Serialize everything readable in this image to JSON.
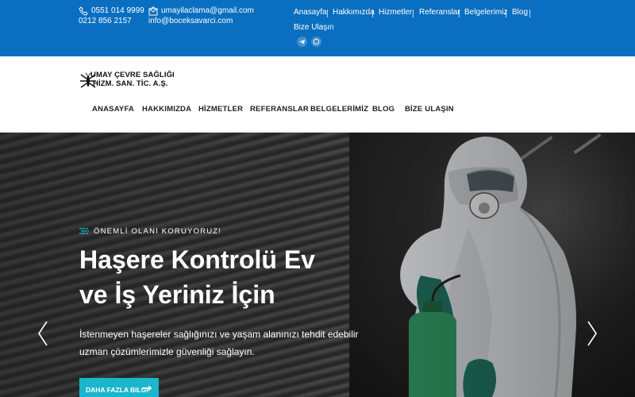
{
  "topbar": {
    "phone1": "0551 014 9999",
    "phone2": "0212 856 2157",
    "email1": "umayilaclama@gmail.com",
    "email2": "info@boceksavarci.com",
    "nav": [
      "Anasayfa",
      "Hakkımızda",
      "Hizmetler",
      "Referanslar",
      "Belgelerimiz",
      "Blog",
      "Bize Ulaşın"
    ],
    "social_icons": [
      "telegram-icon",
      "whatsapp-icon"
    ],
    "bg_color": "#0a6fc0"
  },
  "header": {
    "logo_line1": "UMAY ÇEVRE SAĞLIĞI",
    "logo_line2": "HİZM. SAN. TİC. A.Ş.",
    "nav": [
      "ANASAYFA",
      "HAKKIMIZDA",
      "HİZMETLER",
      "REFERANSLAR",
      "BELGELERİMİZ",
      "BLOG",
      "BİZE ULAŞIN"
    ]
  },
  "hero": {
    "eyebrow": "ÖNEMLİ OLANI KORUYORUZ!",
    "headline_line1": "Haşere Kontrolü Ev",
    "headline_line2": "ve İş Yeriniz İçin",
    "desc_line1": "İstenmeyen haşereler sağlığınızı ve yaşam alanınızı tehdit edebilir",
    "desc_line2": "uzman çözümlerimizle güvenliği sağlayın.",
    "cta_label": "DAHA FAZLA BILGI",
    "accent_color": "#1bb6cc"
  }
}
